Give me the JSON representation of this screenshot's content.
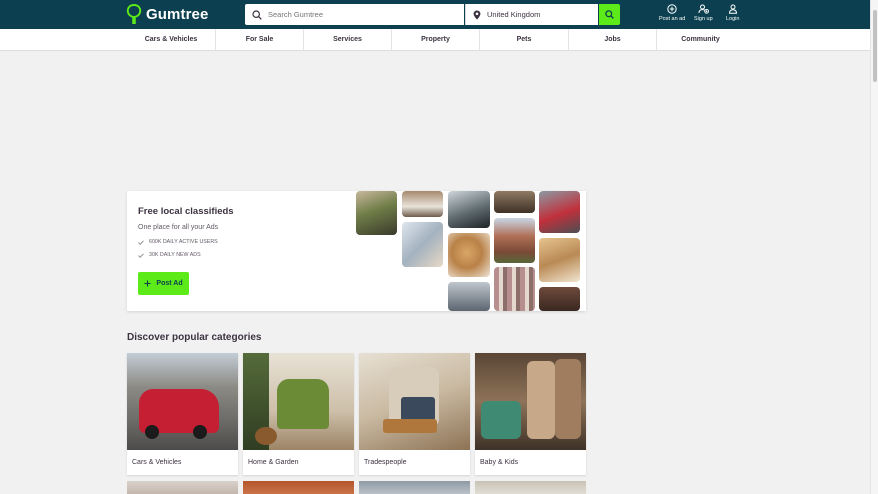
{
  "header": {
    "logo_text": "Gumtree",
    "search_placeholder": "Search Gumtree",
    "location_value": "United Kingdom",
    "actions": [
      {
        "label": "Post an ad",
        "icon": "plus-circle-icon"
      },
      {
        "label": "Sign up",
        "icon": "add-user-icon"
      },
      {
        "label": "Login",
        "icon": "user-icon"
      }
    ]
  },
  "nav": {
    "items": [
      "Cars & Vehicles",
      "For Sale",
      "Services",
      "Property",
      "Pets",
      "Jobs",
      "Community"
    ]
  },
  "hero": {
    "title": "Free local classifieds",
    "subtitle": "One place for all your Ads",
    "stats": [
      "600K DAILY ACTIVE USERS",
      "30K DAILY NEW ADS"
    ],
    "button_label": "Post Ad"
  },
  "categories": {
    "heading": "Discover popular categories",
    "items": [
      "Cars & Vehicles",
      "Home & Garden",
      "Tradespeople",
      "Baby & Kids"
    ]
  },
  "colors": {
    "brand_dark": "#0c4050",
    "accent_green": "#5cea18",
    "text": "#3c3241"
  }
}
